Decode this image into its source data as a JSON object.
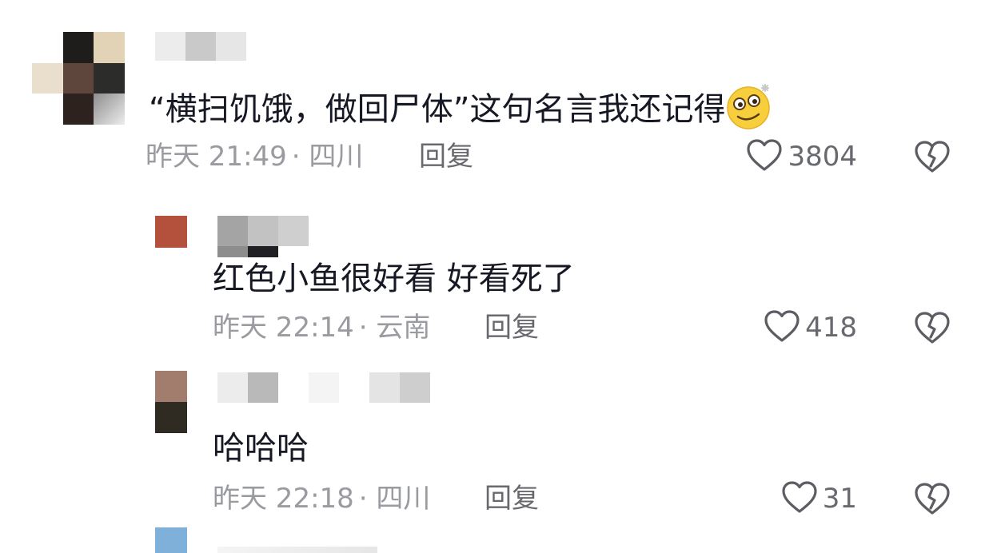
{
  "comments": [
    {
      "text": "“横扫饥饿，做回尸体”这句名言我还记得",
      "emoji": "woozy-face-emoji",
      "time": "昨天 21:49",
      "location": "· 四川",
      "reply_label": "回复",
      "likes": "3804"
    },
    {
      "text": "红色小鱼很好看 好看死了",
      "time": "昨天 22:14",
      "location": "· 云南",
      "reply_label": "回复",
      "likes": "418"
    },
    {
      "text": "哈哈哈",
      "time": "昨天 22:18",
      "location": "· 四川",
      "reply_label": "回复",
      "likes": "31"
    }
  ],
  "colors": {
    "text": "#161823",
    "meta": "#9a9ba0",
    "action": "#68696f",
    "icon": "#5c5d63"
  }
}
